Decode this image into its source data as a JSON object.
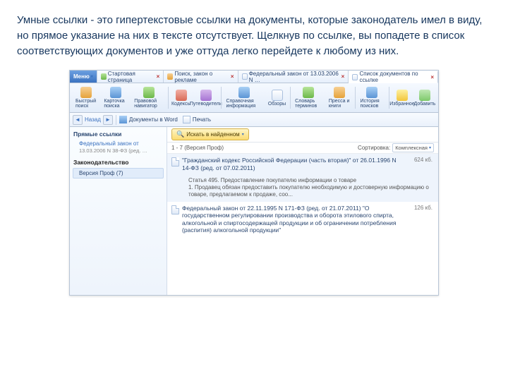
{
  "slide": {
    "text": "Умные ссылки - это гипертекстовые ссылки на документы, которые законодатель имел в виду, но прямое указание на них в тексте отсутствует. Щелкнув по ссылке, вы попадете в список соответствующих документов и уже оттуда легко перейдете к любому из них."
  },
  "tabs": {
    "menu": "Меню",
    "items": [
      "Стартовая страница",
      "Поиск, закон о рекламе",
      "Федеральный закон от 13.03.2006 N …",
      "Список документов по ссылке"
    ],
    "active_index": 3
  },
  "toolbar": {
    "groups": [
      {
        "items": [
          {
            "label": "Быстрый поиск",
            "icon": "ic-orange"
          },
          {
            "label": "Карточка поиска",
            "icon": "ic-blue"
          },
          {
            "label": "Правовой навигатор",
            "icon": "ic-green"
          }
        ]
      },
      {
        "items": [
          {
            "label": "Кодексы",
            "icon": "ic-red"
          },
          {
            "label": "Путеводители",
            "icon": "ic-purple"
          }
        ]
      },
      {
        "items": [
          {
            "label": "Справочная информация",
            "icon": "ic-blue"
          },
          {
            "label": "Обзоры",
            "icon": "ic-doc"
          }
        ]
      },
      {
        "items": [
          {
            "label": "Словарь терминов",
            "icon": "ic-green"
          },
          {
            "label": "Пресса и книги",
            "icon": "ic-orange"
          }
        ]
      },
      {
        "items": [
          {
            "label": "История поисков",
            "icon": "ic-blue"
          }
        ]
      },
      {
        "items": [
          {
            "label": "Избранное",
            "icon": "ic-star"
          },
          {
            "label": "Добавить",
            "icon": "ic-plus"
          }
        ]
      }
    ]
  },
  "nav": {
    "back": "Назад",
    "docs_in_word": "Документы в Word",
    "print": "Печать",
    "search_btn": "Искать в найденном"
  },
  "sidebar": {
    "direct_links": "Прямые ссылки",
    "doc_link": "Федеральный закон от",
    "doc_date": "13.03.2006 N 38-ФЗ (ред. …",
    "legislation": "Законодательство",
    "prof_version": "Версия Проф  (7)"
  },
  "content": {
    "count_line": "1 - 7 (Версия Проф)",
    "sort_label": "Сортировка:",
    "sort_value": "Комплексная"
  },
  "results": [
    {
      "title": "\"Гражданский кодекс Российской Федерации (часть вторая)\" от 26.01.1996 N 14-ФЗ (ред. от 07.02.2011)",
      "size": "624 кб.",
      "snippet": "Статья 495. Предоставление покупателю информации о товаре\n1. Продавец обязан предоставить покупателю необходимую и достоверную информацию о товаре, предлагаемом к продаже, соо..."
    },
    {
      "title": "Федеральный закон от 22.11.1995 N 171-ФЗ (ред. от 21.07.2011) \"О государственном регулировании производства и оборота этилового спирта, алкогольной и спиртосодержащей продукции и об ограничении потребления (распития) алкогольной продукции\"",
      "size": "126 кб.",
      "snippet": ""
    }
  ]
}
